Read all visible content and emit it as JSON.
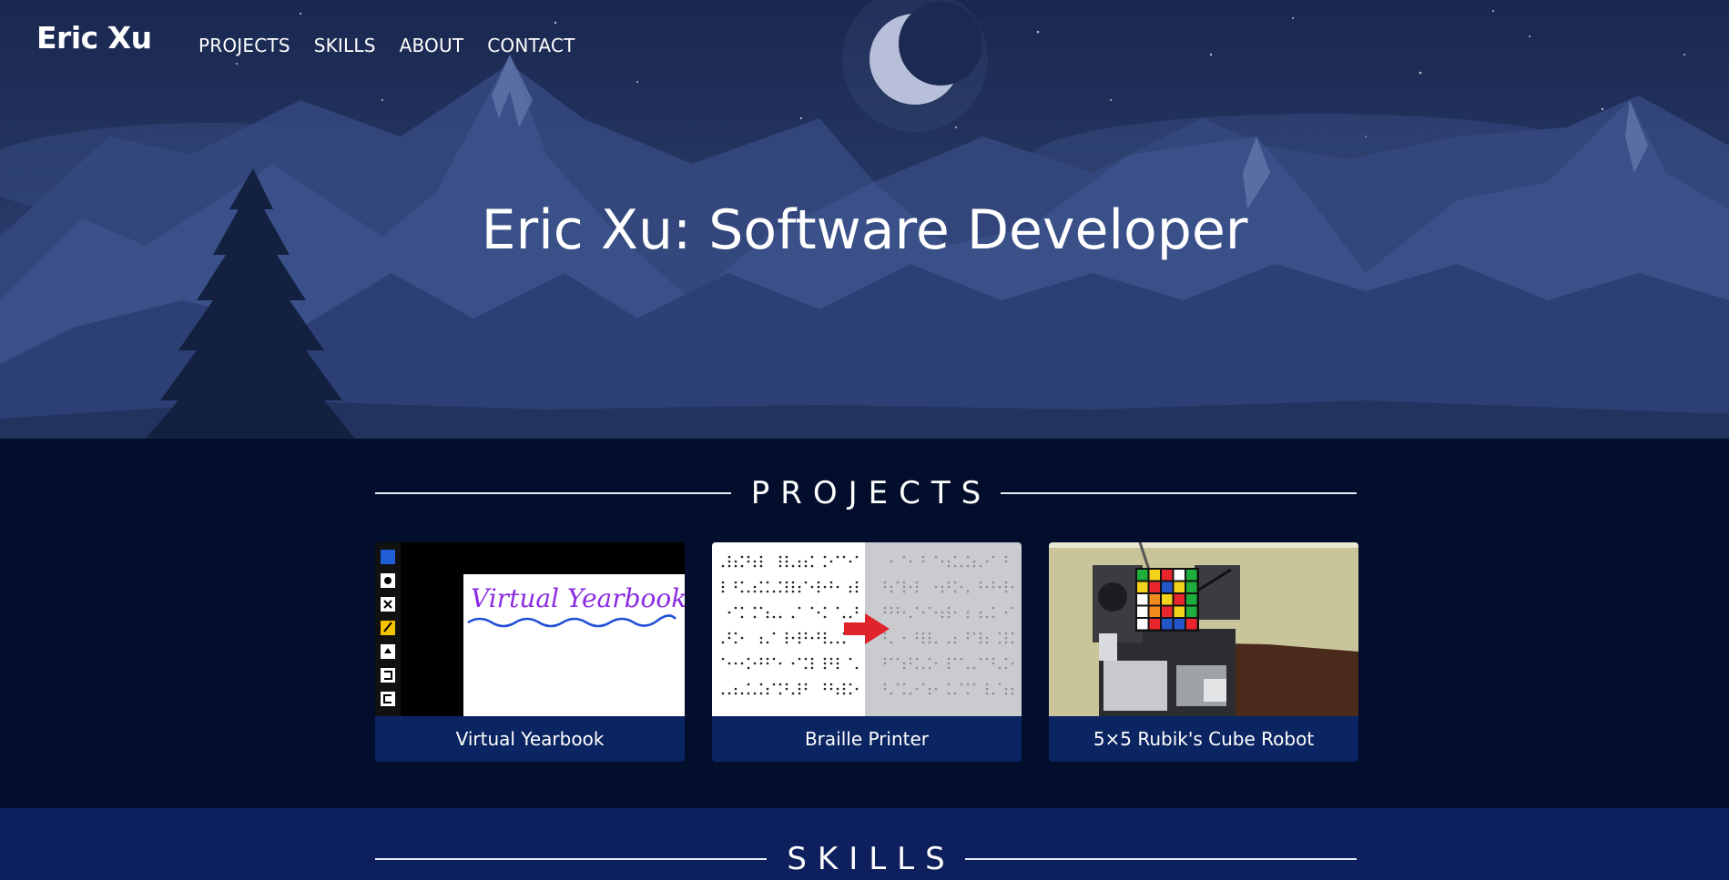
{
  "nav": {
    "brand": "Eric Xu",
    "links": [
      "PROJECTS",
      "SKILLS",
      "ABOUT",
      "CONTACT"
    ]
  },
  "hero": {
    "title": "Eric Xu: Software Developer"
  },
  "projects": {
    "heading": "PROJECTS",
    "cards": [
      {
        "caption": "Virtual Yearbook",
        "thumb_text": "Virtual Yearbook"
      },
      {
        "caption": "Braille Printer"
      },
      {
        "caption": "5×5 Rubik's Cube Robot"
      }
    ]
  },
  "skills": {
    "heading": "SKILLS"
  },
  "colors": {
    "hero_sky": "#243561",
    "page_bg": "#020e2c",
    "card_caption_bg": "#0b2462",
    "skills_bg": "#0d1f5c",
    "text": "#ffffff"
  }
}
